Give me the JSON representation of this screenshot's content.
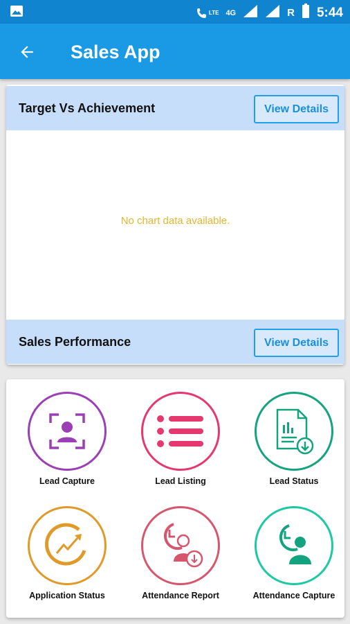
{
  "status_bar": {
    "lte": "LTE",
    "network": "4G",
    "roaming": "R",
    "time": "5:44"
  },
  "app_bar": {
    "title": "Sales App"
  },
  "sections": [
    {
      "title": "Target Vs Achievement",
      "button": "View Details",
      "empty_text": "No chart data available."
    },
    {
      "title": "Sales Performance",
      "button": "View Details"
    }
  ],
  "menu": [
    {
      "label": "Lead Capture",
      "icon": "lead-capture-icon",
      "color": "#9b3fb7"
    },
    {
      "label": "Lead Listing",
      "icon": "list-icon",
      "color": "#e5386f"
    },
    {
      "label": "Lead Status",
      "icon": "report-download-icon",
      "color": "#14a37f"
    },
    {
      "label": "Application Status",
      "icon": "growth-chart-icon",
      "color": "#e09a2a"
    },
    {
      "label": "Attendance Report",
      "icon": "attendance-report-icon",
      "color": "#d6566e"
    },
    {
      "label": "Attendance Capture",
      "icon": "attendance-capture-icon",
      "color": "#1cc9a3"
    }
  ],
  "colors": {
    "status_bar": "#1084cf",
    "app_bar": "#1a9ae4",
    "section_header": "#c7defb",
    "button_accent": "#1fa0e8",
    "empty_text": "#e5b62c"
  }
}
